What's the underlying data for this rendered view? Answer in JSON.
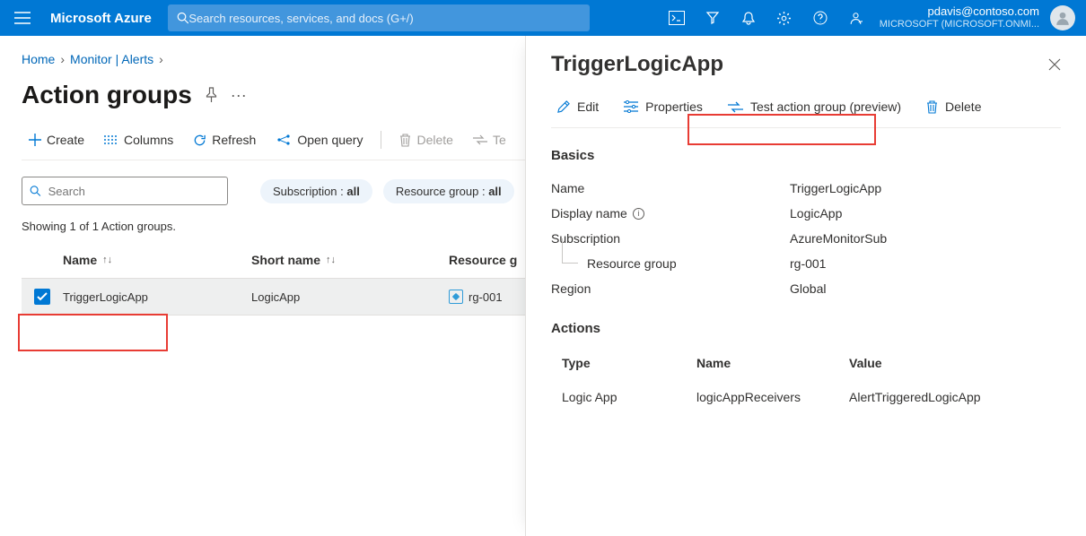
{
  "topbar": {
    "brand": "Microsoft Azure",
    "search_placeholder": "Search resources, services, and docs (G+/)",
    "account_email": "pdavis@contoso.com",
    "account_tenant": "MICROSOFT (MICROSOFT.ONMI..."
  },
  "crumbs": {
    "home": "Home",
    "monitor": "Monitor | Alerts"
  },
  "header": {
    "title": "Action groups"
  },
  "toolbar": {
    "create": "Create",
    "columns": "Columns",
    "refresh": "Refresh",
    "openquery": "Open query",
    "delete": "Delete",
    "te": "Te"
  },
  "filters": {
    "search_placeholder": "Search",
    "subscription_label": "Subscription : ",
    "subscription_value": "all",
    "rg_label": "Resource group : ",
    "rg_value": "all"
  },
  "status": "Showing 1 of 1 Action groups.",
  "table": {
    "head_name": "Name",
    "head_short": "Short name",
    "head_rg": "Resource g",
    "row_name": "TriggerLogicApp",
    "row_short": "LogicApp",
    "row_rg": "rg-001"
  },
  "pane": {
    "title": "TriggerLogicApp",
    "edit": "Edit",
    "properties": "Properties",
    "test": "Test action group (preview)",
    "delete": "Delete",
    "basics": "Basics",
    "k_name": "Name",
    "v_name": "TriggerLogicApp",
    "k_display": "Display name",
    "v_display": "LogicApp",
    "k_sub": "Subscription",
    "v_sub": "AzureMonitorSub",
    "k_rg": "Resource group",
    "v_rg": "rg-001",
    "k_region": "Region",
    "v_region": "Global",
    "actions": "Actions",
    "a_type": "Type",
    "a_name": "Name",
    "a_value": "Value",
    "r_type": "Logic App",
    "r_name": "logicAppReceivers",
    "r_value": "AlertTriggeredLogicApp"
  }
}
